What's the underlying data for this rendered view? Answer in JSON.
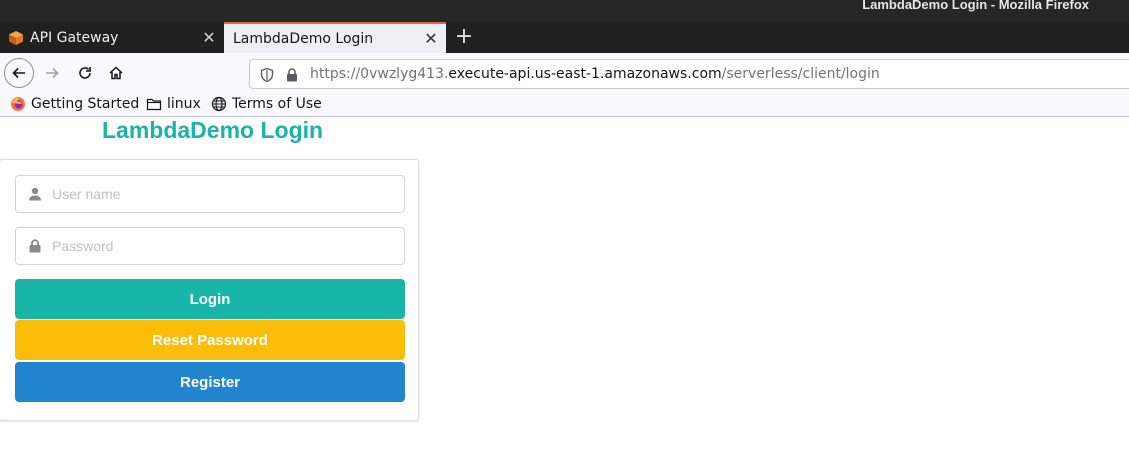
{
  "window": {
    "title": "LambdaDemo Login - Mozilla Firefox"
  },
  "tabs": [
    {
      "label": "API Gateway",
      "icon": "api-gateway-icon",
      "active": false
    },
    {
      "label": "LambdaDemo Login",
      "icon": null,
      "active": true
    }
  ],
  "toolbar": {
    "url_prefix": "https://0vwzlyg413.",
    "url_host": "execute-api.us-east-1.amazonaws.com",
    "url_path": "/serverless/client/login"
  },
  "bookmarks": [
    {
      "label": "Getting Started",
      "icon": "firefox-icon"
    },
    {
      "label": "linux",
      "icon": "folder-icon"
    },
    {
      "label": "Terms of Use",
      "icon": "globe-icon"
    }
  ],
  "page": {
    "heading": "LambdaDemo Login",
    "username_placeholder": "User name",
    "password_placeholder": "Password",
    "login_label": "Login",
    "reset_label": "Reset Password",
    "register_label": "Register"
  },
  "colors": {
    "heading": "#1ab3a9",
    "login": "#18b5a9",
    "reset": "#fbbd08",
    "register": "#2185d0"
  }
}
